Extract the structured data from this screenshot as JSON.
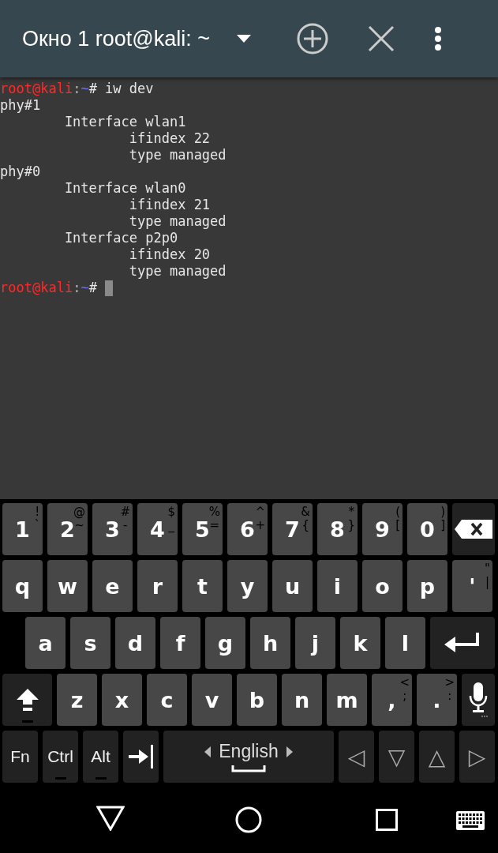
{
  "toolbar": {
    "title": "Окно 1 root@kali: ~"
  },
  "terminal": {
    "cursor_visible": true,
    "lines": [
      {
        "segments": [
          {
            "kind": "user",
            "text": "root@kali"
          },
          {
            "kind": "sep",
            "text": ":"
          },
          {
            "kind": "path",
            "text": "~"
          },
          {
            "kind": "text",
            "text": "# iw dev"
          }
        ]
      },
      {
        "segments": [
          {
            "kind": "text",
            "text": "phy#1"
          }
        ]
      },
      {
        "segments": [
          {
            "kind": "text",
            "text": "        Interface wlan1"
          }
        ]
      },
      {
        "segments": [
          {
            "kind": "text",
            "text": "                ifindex 22"
          }
        ]
      },
      {
        "segments": [
          {
            "kind": "text",
            "text": "                type managed"
          }
        ]
      },
      {
        "segments": [
          {
            "kind": "text",
            "text": "phy#0"
          }
        ]
      },
      {
        "segments": [
          {
            "kind": "text",
            "text": "        Interface wlan0"
          }
        ]
      },
      {
        "segments": [
          {
            "kind": "text",
            "text": "                ifindex 21"
          }
        ]
      },
      {
        "segments": [
          {
            "kind": "text",
            "text": "                type managed"
          }
        ]
      },
      {
        "segments": [
          {
            "kind": "text",
            "text": "        Interface p2p0"
          }
        ]
      },
      {
        "segments": [
          {
            "kind": "text",
            "text": "                ifindex 20"
          }
        ]
      },
      {
        "segments": [
          {
            "kind": "text",
            "text": "                type managed"
          }
        ]
      },
      {
        "segments": [
          {
            "kind": "user",
            "text": "root@kali"
          },
          {
            "kind": "sep",
            "text": ":"
          },
          {
            "kind": "path",
            "text": "~"
          },
          {
            "kind": "text",
            "text": "# "
          }
        ]
      }
    ]
  },
  "keyboard": {
    "rows": [
      {
        "keys": [
          {
            "kind": "char",
            "label": "1",
            "hints": [
              "!",
              "`"
            ]
          },
          {
            "kind": "char",
            "label": "2",
            "hints": [
              "@",
              "~"
            ]
          },
          {
            "kind": "char",
            "label": "3",
            "hints": [
              "#",
              "-"
            ]
          },
          {
            "kind": "char",
            "label": "4",
            "hints": [
              "$",
              "_"
            ]
          },
          {
            "kind": "char",
            "label": "5",
            "hints": [
              "%",
              "="
            ]
          },
          {
            "kind": "char",
            "label": "6",
            "hints": [
              "^",
              "+"
            ]
          },
          {
            "kind": "char",
            "label": "7",
            "hints": [
              "&",
              "{"
            ]
          },
          {
            "kind": "char",
            "label": "8",
            "hints": [
              "*",
              "}"
            ]
          },
          {
            "kind": "char",
            "label": "9",
            "hints": [
              "(",
              "["
            ]
          },
          {
            "kind": "char",
            "label": "0",
            "hints": [
              ")",
              "]"
            ]
          },
          {
            "kind": "backspace"
          }
        ]
      },
      {
        "keys": [
          {
            "kind": "char",
            "label": "q"
          },
          {
            "kind": "char",
            "label": "w"
          },
          {
            "kind": "char",
            "label": "e"
          },
          {
            "kind": "char",
            "label": "r"
          },
          {
            "kind": "char",
            "label": "t"
          },
          {
            "kind": "char",
            "label": "y"
          },
          {
            "kind": "char",
            "label": "u"
          },
          {
            "kind": "char",
            "label": "i"
          },
          {
            "kind": "char",
            "label": "o"
          },
          {
            "kind": "char",
            "label": "p"
          },
          {
            "kind": "char",
            "label": "'",
            "hints": [
              "\"",
              "|"
            ]
          }
        ]
      },
      {
        "keys": [
          {
            "kind": "char",
            "label": "a"
          },
          {
            "kind": "char",
            "label": "s"
          },
          {
            "kind": "char",
            "label": "d"
          },
          {
            "kind": "char",
            "label": "f"
          },
          {
            "kind": "char",
            "label": "g"
          },
          {
            "kind": "char",
            "label": "h"
          },
          {
            "kind": "char",
            "label": "j"
          },
          {
            "kind": "char",
            "label": "k"
          },
          {
            "kind": "char",
            "label": "l"
          },
          {
            "kind": "enter"
          }
        ]
      },
      {
        "keys": [
          {
            "kind": "shift",
            "lock_indicator": true
          },
          {
            "kind": "char",
            "label": "z"
          },
          {
            "kind": "char",
            "label": "x"
          },
          {
            "kind": "char",
            "label": "c"
          },
          {
            "kind": "char",
            "label": "v"
          },
          {
            "kind": "char",
            "label": "b"
          },
          {
            "kind": "char",
            "label": "n"
          },
          {
            "kind": "char",
            "label": "m"
          },
          {
            "kind": "char",
            "label": ",",
            "hints": [
              "<",
              ";"
            ]
          },
          {
            "kind": "char",
            "label": ".",
            "hints": [
              ">",
              ":"
            ]
          },
          {
            "kind": "mic"
          }
        ]
      },
      {
        "keys": [
          {
            "kind": "mod",
            "label": "Fn",
            "lock_indicator": false
          },
          {
            "kind": "mod",
            "label": "Ctrl",
            "lock_indicator": true
          },
          {
            "kind": "mod",
            "label": "Alt",
            "lock_indicator": true
          },
          {
            "kind": "tab"
          },
          {
            "kind": "space",
            "label": "English"
          },
          {
            "kind": "arrow",
            "label": "◁"
          },
          {
            "kind": "arrow",
            "label": "▽"
          },
          {
            "kind": "arrow",
            "label": "△"
          },
          {
            "kind": "arrow",
            "label": "▷"
          }
        ]
      }
    ]
  }
}
